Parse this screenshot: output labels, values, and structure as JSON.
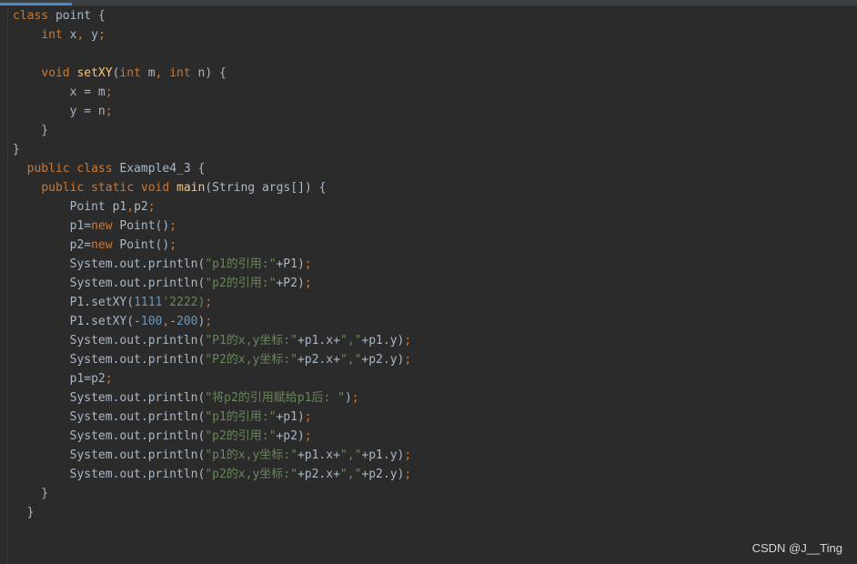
{
  "editor": {
    "lines": [
      [
        [
          "kw",
          "class"
        ],
        [
          "pl",
          " point {"
        ]
      ],
      [
        [
          "pl",
          "    "
        ],
        [
          "kw",
          "int"
        ],
        [
          "pl",
          " x"
        ],
        [
          "pu",
          ","
        ],
        [
          "pl",
          " y"
        ],
        [
          "pu",
          ";"
        ]
      ],
      [
        [
          "pl",
          ""
        ]
      ],
      [
        [
          "pl",
          "    "
        ],
        [
          "kw",
          "void"
        ],
        [
          "pl",
          " "
        ],
        [
          "fn",
          "setXY"
        ],
        [
          "pl",
          "("
        ],
        [
          "kw",
          "int"
        ],
        [
          "pl",
          " m"
        ],
        [
          "pu",
          ","
        ],
        [
          "pl",
          " "
        ],
        [
          "kw",
          "int"
        ],
        [
          "pl",
          " n) {"
        ]
      ],
      [
        [
          "pl",
          "        x = m"
        ],
        [
          "pu",
          ";"
        ]
      ],
      [
        [
          "pl",
          "        y = n"
        ],
        [
          "pu",
          ";"
        ]
      ],
      [
        [
          "pl",
          "    }"
        ]
      ],
      [
        [
          "pl",
          "}"
        ]
      ],
      [
        [
          "pl",
          "  "
        ],
        [
          "kw",
          "public class"
        ],
        [
          "pl",
          " Example4_3 {"
        ]
      ],
      [
        [
          "pl",
          "    "
        ],
        [
          "kw",
          "public static void"
        ],
        [
          "pl",
          " "
        ],
        [
          "fn",
          "main"
        ],
        [
          "pl",
          "(String args[]) {"
        ]
      ],
      [
        [
          "pl",
          "        Point p1"
        ],
        [
          "pu",
          ","
        ],
        [
          "pl",
          "p2"
        ],
        [
          "pu",
          ";"
        ]
      ],
      [
        [
          "pl",
          "        p1="
        ],
        [
          "kw",
          "new"
        ],
        [
          "pl",
          " Point()"
        ],
        [
          "pu",
          ";"
        ]
      ],
      [
        [
          "pl",
          "        p2="
        ],
        [
          "kw",
          "new"
        ],
        [
          "pl",
          " Point()"
        ],
        [
          "pu",
          ";"
        ]
      ],
      [
        [
          "pl",
          "        System.out.println("
        ],
        [
          "str",
          "\"p1的引用:\""
        ],
        [
          "pl",
          "+P1)"
        ],
        [
          "pu",
          ";"
        ]
      ],
      [
        [
          "pl",
          "        System.out.println("
        ],
        [
          "str",
          "\"p2的引用:\""
        ],
        [
          "pl",
          "+P2)"
        ],
        [
          "pu",
          ";"
        ]
      ],
      [
        [
          "pl",
          "        P1.setXY("
        ],
        [
          "num",
          "1111"
        ],
        [
          "str",
          "'2222)"
        ],
        [
          "pu",
          ";"
        ]
      ],
      [
        [
          "pl",
          "        P1.setXY(-"
        ],
        [
          "num",
          "100"
        ],
        [
          "pu",
          ","
        ],
        [
          "pl",
          "-"
        ],
        [
          "num",
          "200"
        ],
        [
          "pl",
          ")"
        ],
        [
          "pu",
          ";"
        ]
      ],
      [
        [
          "pl",
          "        System.out.println("
        ],
        [
          "str",
          "\"P1的x,y坐标:\""
        ],
        [
          "pl",
          "+p1.x+"
        ],
        [
          "str",
          "\",\""
        ],
        [
          "pl",
          "+p1.y)"
        ],
        [
          "pu",
          ";"
        ]
      ],
      [
        [
          "pl",
          "        System.out.println("
        ],
        [
          "str",
          "\"P2的x,y坐标:\""
        ],
        [
          "pl",
          "+p2.x+"
        ],
        [
          "str",
          "\",\""
        ],
        [
          "pl",
          "+p2.y)"
        ],
        [
          "pu",
          ";"
        ]
      ],
      [
        [
          "pl",
          "        p1=p2"
        ],
        [
          "pu",
          ";"
        ]
      ],
      [
        [
          "pl",
          "        System.out.println("
        ],
        [
          "str",
          "\"将p2的引用赋给p1后: \""
        ],
        [
          "pl",
          ")"
        ],
        [
          "pu",
          ";"
        ]
      ],
      [
        [
          "pl",
          "        System.out.println("
        ],
        [
          "str",
          "\"p1的引用:\""
        ],
        [
          "pl",
          "+p1)"
        ],
        [
          "pu",
          ";"
        ]
      ],
      [
        [
          "pl",
          "        System.out.println("
        ],
        [
          "str",
          "\"p2的引用:\""
        ],
        [
          "pl",
          "+p2)"
        ],
        [
          "pu",
          ";"
        ]
      ],
      [
        [
          "pl",
          "        System.out.println("
        ],
        [
          "str",
          "\"p1的x,y坐标:\""
        ],
        [
          "pl",
          "+p1.x+"
        ],
        [
          "str",
          "\",\""
        ],
        [
          "pl",
          "+p1.y)"
        ],
        [
          "pu",
          ";"
        ]
      ],
      [
        [
          "pl",
          "        System.out.println("
        ],
        [
          "str",
          "\"p2的x,y坐标:\""
        ],
        [
          "pl",
          "+p2.x+"
        ],
        [
          "str",
          "\",\""
        ],
        [
          "pl",
          "+p2.y)"
        ],
        [
          "pu",
          ";"
        ]
      ],
      [
        [
          "pl",
          "    }"
        ]
      ],
      [
        [
          "pl",
          "  }"
        ]
      ]
    ]
  },
  "colors": {
    "background": "#2b2b2b",
    "keyword": "#cc7832",
    "plain": "#a9b7c6",
    "method": "#ffc66d",
    "string": "#6a8759",
    "number": "#6897bb"
  },
  "watermark": "CSDN @J__Ting"
}
